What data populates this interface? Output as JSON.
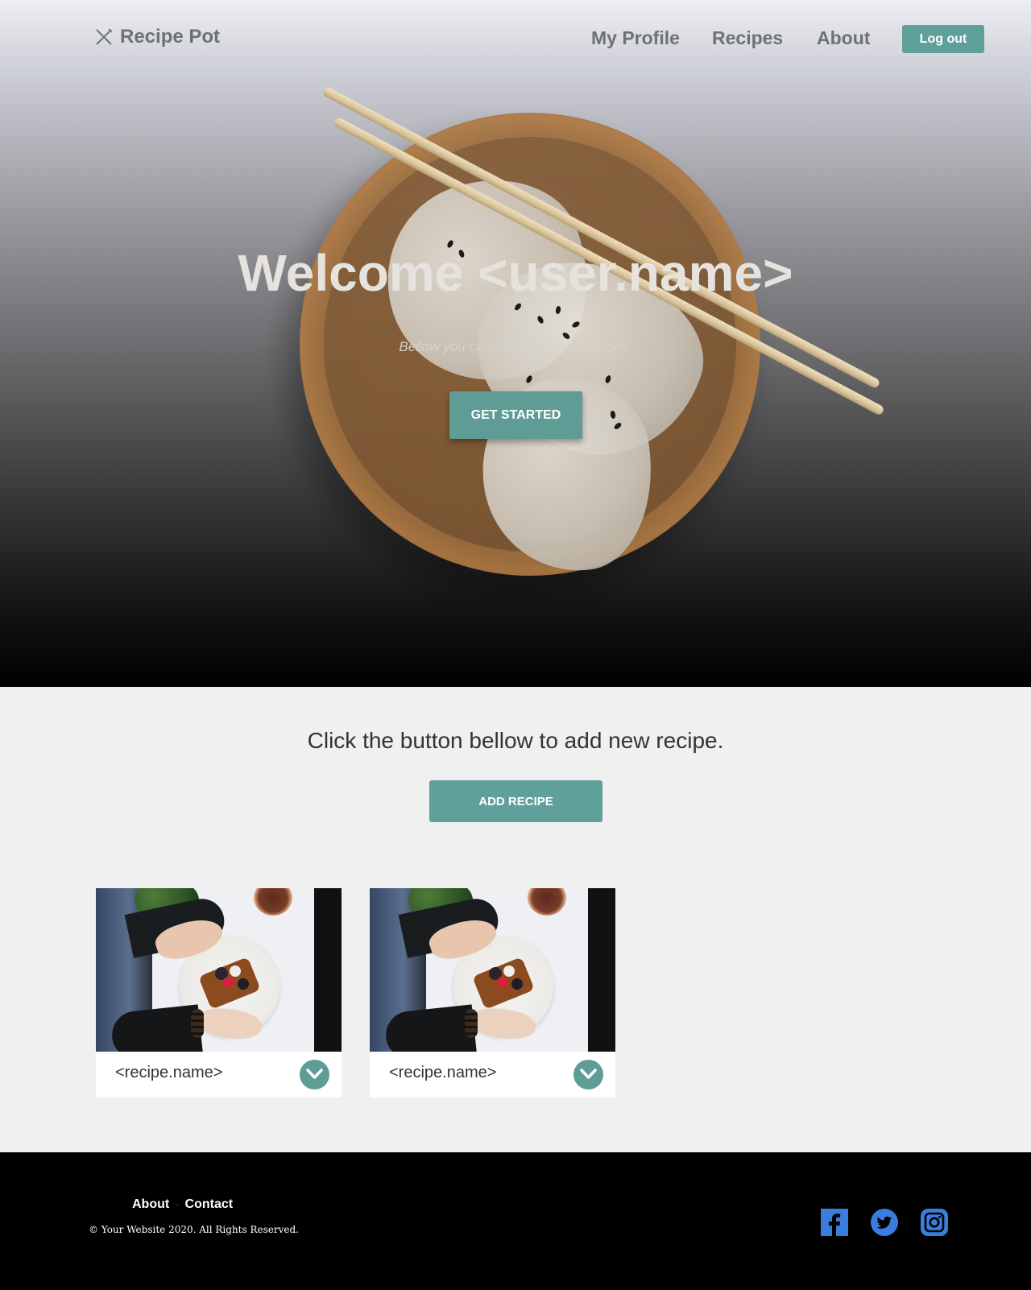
{
  "nav": {
    "brand": "Recipe Pot",
    "links": [
      "My Profile",
      "Recipes",
      "About"
    ],
    "logout": "Log out"
  },
  "hero": {
    "title": "Welcome <user.name>",
    "subtitle": "Bellow you can find all of your recipes.",
    "cta": "GET STARTED"
  },
  "main": {
    "prompt": "Click the button bellow to add new recipe.",
    "add_button": "ADD RECIPE",
    "cards": [
      {
        "title": "<recipe.name>"
      },
      {
        "title": "<recipe.name>"
      }
    ]
  },
  "footer": {
    "links": [
      "About",
      "Contact"
    ],
    "separator": "·",
    "copyright": "© Your Website 2020. All Rights Reserved.",
    "social": [
      "facebook-icon",
      "twitter-icon",
      "instagram-icon"
    ]
  },
  "colors": {
    "accent": "#60a09a",
    "nav_text": "#6f7179",
    "social": "#3b7ddd"
  }
}
